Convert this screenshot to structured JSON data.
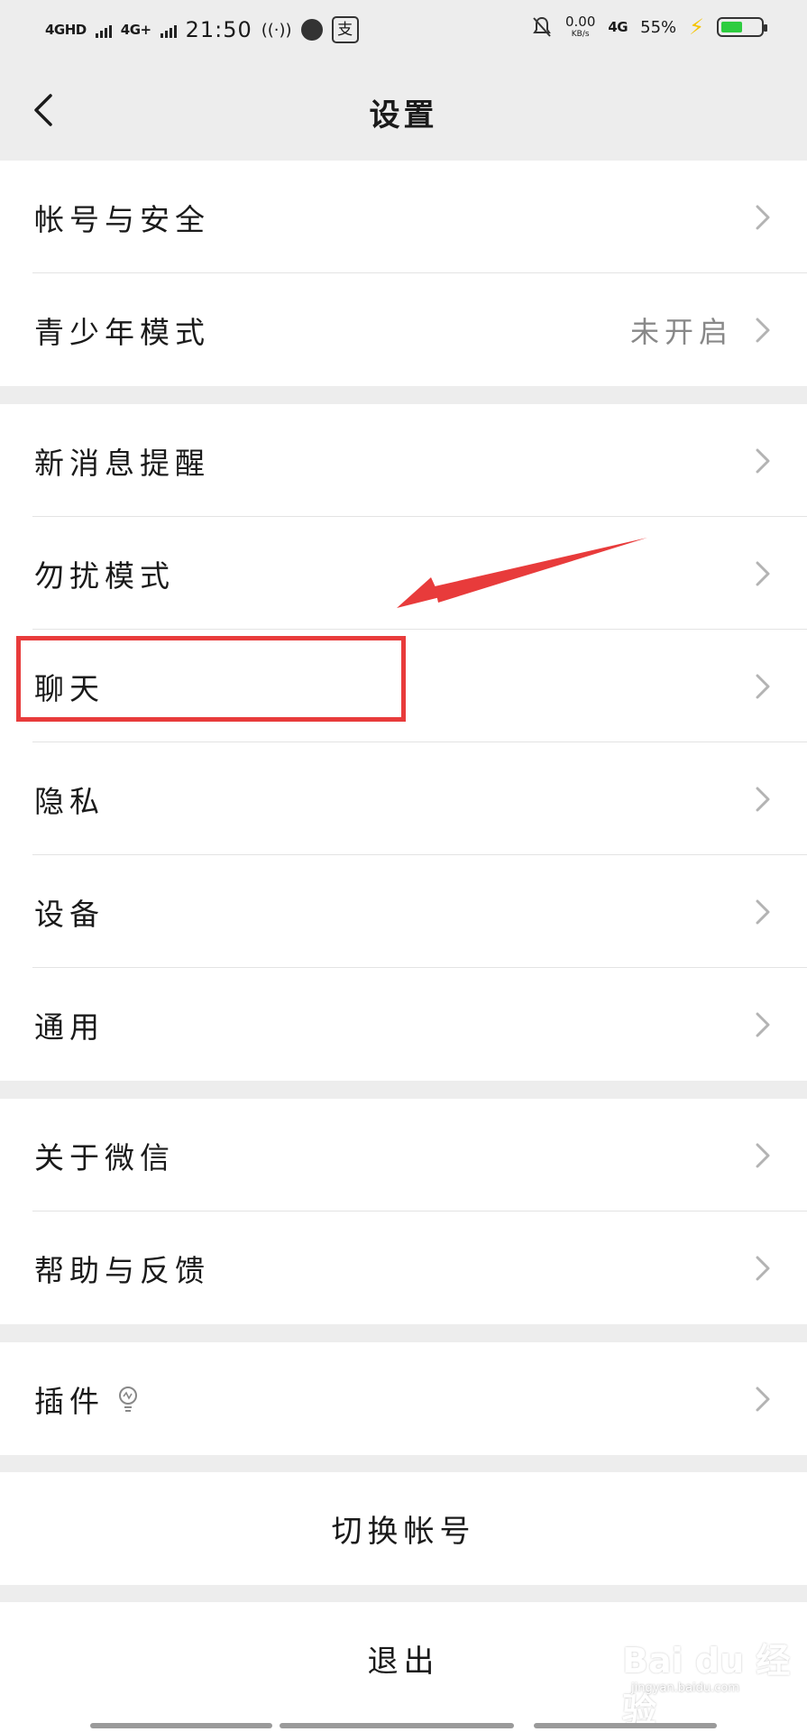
{
  "status_bar": {
    "net1": "4GHD",
    "net2": "4G+",
    "time": "21:50",
    "alipay_glyph": "支",
    "speed_value": "0.00",
    "speed_unit": "KB/s",
    "net3": "4G",
    "battery": "55%",
    "battery_level": 0.55,
    "battery_color": "#2ecc40",
    "icons": [
      "signal-bars-icon",
      "hotspot-icon",
      "app-dot-icon",
      "alipay-icon",
      "mute-bell-icon",
      "charging-bolt-icon",
      "battery-icon"
    ]
  },
  "nav": {
    "title": "设置",
    "back_icon": "chevron-left-icon"
  },
  "groups": [
    {
      "items": [
        {
          "label": "帐号与安全"
        },
        {
          "label": "青少年模式",
          "value": "未开启"
        }
      ]
    },
    {
      "items": [
        {
          "label": "新消息提醒"
        },
        {
          "label": "勿扰模式"
        },
        {
          "label": "聊天"
        },
        {
          "label": "隐私"
        },
        {
          "label": "设备"
        },
        {
          "label": "通用"
        }
      ]
    },
    {
      "items": [
        {
          "label": "关于微信"
        },
        {
          "label": "帮助与反馈"
        }
      ]
    },
    {
      "items": [
        {
          "label": "插件",
          "icon": "lightbulb-icon"
        }
      ]
    }
  ],
  "switch_account": "切换帐号",
  "logout": "退出",
  "annotation": {
    "highlight_color": "#e83b3b"
  },
  "watermark": {
    "text": "Bai du 经验",
    "url": "jingyan.baidu.com"
  }
}
